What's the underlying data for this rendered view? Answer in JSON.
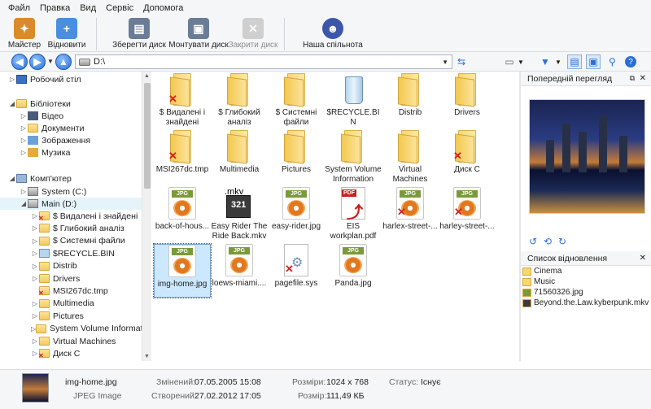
{
  "menu": [
    "Файл",
    "Правка",
    "Вид",
    "Сервіс",
    "Допомога"
  ],
  "toolbar": {
    "wizard": "Майстер",
    "restore": "Відновити",
    "save_disk": "Зберегти диск",
    "mount_disk": "Монтувати диск",
    "close_disk": "Закрити диск",
    "community": "Наша спільнота"
  },
  "address": {
    "path": "D:\\"
  },
  "tree": {
    "desktop": "Робочий стіл",
    "libraries": "Бібліотеки",
    "video": "Відео",
    "documents": "Документи",
    "images": "Зображення",
    "music": "Музика",
    "computer": "Комп'ютер",
    "system_c": "System (C:)",
    "main_d": "Main (D:)",
    "d_items": [
      "$ Видалені і знайдені",
      "$ Глибокий аналіз",
      "$ Системні файли",
      "$RECYCLE.BIN",
      "Distrib",
      "Drivers",
      "MSI267dc.tmp",
      "Multimedia",
      "Pictures",
      "System Volume Informati",
      "Virtual Machines",
      "Диск С"
    ]
  },
  "files": [
    {
      "name": "$ Видалені і знайдені",
      "type": "folder",
      "deleted": true
    },
    {
      "name": "$ Глибокий аналіз",
      "type": "folder",
      "deleted": false
    },
    {
      "name": "$ Системні файли",
      "type": "folder",
      "deleted": false
    },
    {
      "name": "$RECYCLE.BIN",
      "type": "recycle",
      "deleted": false
    },
    {
      "name": "Distrib",
      "type": "folder",
      "deleted": false
    },
    {
      "name": "Drivers",
      "type": "folder",
      "deleted": false
    },
    {
      "name": "MSI267dc.tmp",
      "type": "folder",
      "deleted": true
    },
    {
      "name": "Multimedia",
      "type": "folder",
      "deleted": false
    },
    {
      "name": "Pictures",
      "type": "folder",
      "deleted": false
    },
    {
      "name": "System Volume Information",
      "type": "folder",
      "deleted": false
    },
    {
      "name": "Virtual Machines",
      "type": "folder",
      "deleted": false
    },
    {
      "name": "Диск С",
      "type": "folder",
      "deleted": true
    },
    {
      "name": "back-of-hous...",
      "type": "jpg",
      "deleted": false
    },
    {
      "name": "Easy Rider The Ride Back.mkv",
      "type": "mkv",
      "deleted": false
    },
    {
      "name": "easy-rider.jpg",
      "type": "jpg",
      "deleted": false
    },
    {
      "name": "EIS workplan.pdf",
      "type": "pdf",
      "deleted": false
    },
    {
      "name": "harlex-street-...",
      "type": "jpg",
      "deleted": true
    },
    {
      "name": "harley-street-...",
      "type": "jpg",
      "deleted": true
    },
    {
      "name": "img-home.jpg",
      "type": "jpg",
      "deleted": false
    },
    {
      "name": "loews-miami....",
      "type": "jpg",
      "deleted": false
    },
    {
      "name": "pagefile.sys",
      "type": "sys",
      "deleted": true
    },
    {
      "name": "Panda.jpg",
      "type": "jpg",
      "deleted": false
    }
  ],
  "icon_labels": {
    "jpg": "JPG",
    "mkv": ".mkv",
    "mkv_count": "321",
    "pdf": "PDF"
  },
  "preview": {
    "title": "Попередній перегляд"
  },
  "restore_list": {
    "title": "Список відновлення",
    "items": [
      "Cinema",
      "Music",
      "71560326.jpg",
      "Beyond.the.Law.kyberpunk.mkv"
    ]
  },
  "status": {
    "filename": "img-home.jpg",
    "filetype": "JPEG Image",
    "modified_label": "Змінений:",
    "modified": "07.05.2005 15:08",
    "created_label": "Створений:",
    "created": "27.02.2012 17:05",
    "dims_label": "Розміри:",
    "dims": "1024 x 768",
    "size_label": "Розмір:",
    "size": "111,49 КБ",
    "state_label": "Статус:",
    "state": "Існує"
  }
}
